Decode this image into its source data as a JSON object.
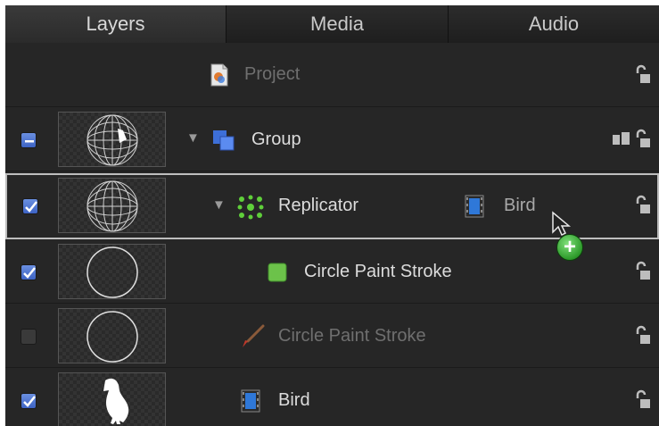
{
  "tabs": [
    {
      "label": "Layers",
      "active": true
    },
    {
      "label": "Media",
      "active": false
    },
    {
      "label": "Audio",
      "active": false
    }
  ],
  "layers": {
    "project": {
      "label": "Project",
      "icon": "project-document-icon"
    },
    "group": {
      "label": "Group",
      "checkbox": "mixed",
      "icon": "group-squares-icon"
    },
    "replicator": {
      "label": "Replicator",
      "checkbox": "checked",
      "icon": "replicator-icon",
      "source_label": "Bird",
      "source_icon": "film-strip-icon"
    },
    "circle_stroke_shape": {
      "label": "Circle Paint Stroke",
      "checkbox": "checked",
      "icon": "green-shape-icon"
    },
    "circle_stroke_disabled": {
      "label": "Circle Paint Stroke",
      "checkbox": "unchecked",
      "icon": "brush-icon"
    },
    "bird": {
      "label": "Bird",
      "checkbox": "checked",
      "icon": "film-strip-icon"
    }
  },
  "colors": {
    "panel_bg": "#262626",
    "selection_border": "#bdbdbd",
    "accent_checkbox": "#4a70d0",
    "add_badge": "#3fb53b"
  }
}
